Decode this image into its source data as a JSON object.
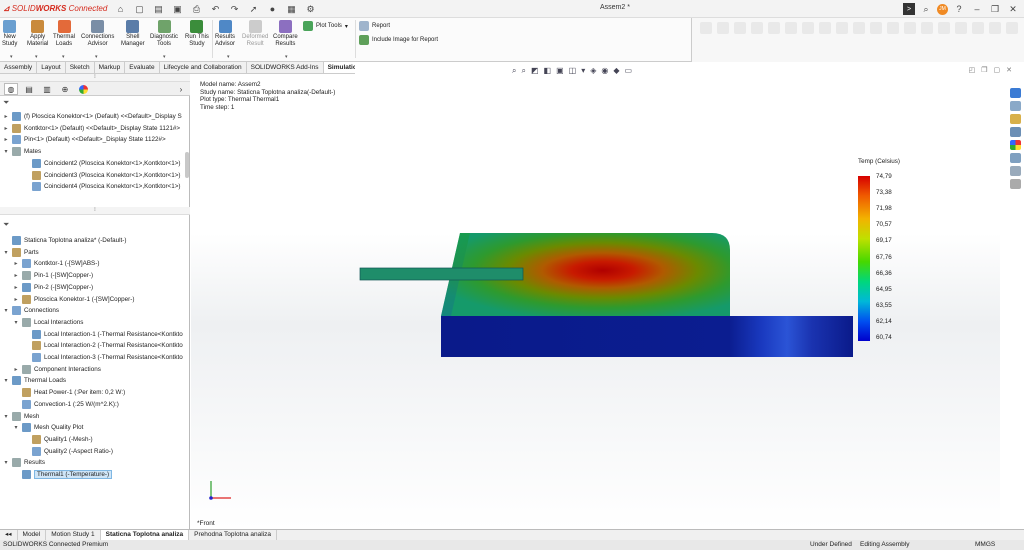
{
  "app": {
    "brand_prefix": "SOLID",
    "brand_bold": "WORKS",
    "brand_rest": " Connected",
    "document_title": "Assem2 *"
  },
  "ribbon": {
    "buttons": [
      {
        "label": "New\nStudy",
        "icon": "new-study-icon"
      },
      {
        "label": "Apply\nMaterial",
        "icon": "apply-material-icon"
      },
      {
        "label": "Thermal\nLoads",
        "icon": "thermal-loads-icon"
      },
      {
        "label": "Connections\nAdvisor",
        "icon": "connections-advisor-icon"
      },
      {
        "label": "Shell\nManager",
        "icon": "shell-manager-icon"
      },
      {
        "label": "Diagnostic\nTools",
        "icon": "diagnostic-tools-icon"
      },
      {
        "label": "Run This\nStudy",
        "icon": "run-study-icon"
      },
      {
        "label": "Results\nAdvisor",
        "icon": "results-advisor-icon"
      },
      {
        "label": "Deformed\nResult",
        "icon": "deformed-result-icon"
      },
      {
        "label": "Compare\nResults",
        "icon": "compare-results-icon"
      }
    ],
    "plot_tools": "Plot Tools",
    "report": "Report",
    "include_image": "Include Image for Report"
  },
  "tabs": [
    "Assembly",
    "Layout",
    "Sketch",
    "Markup",
    "Evaluate",
    "Lifecycle and Collaboration",
    "SOLIDWORKS Add-Ins",
    "Simulation"
  ],
  "active_tab": "Simulation",
  "feature_tree": [
    {
      "text": "(f) Ploscica Konektor<1> (Default) <<Default>_Display S",
      "arrow": "▸"
    },
    {
      "text": "Kontktor<1> (Default) <<Default>_Display State 1121#>",
      "arrow": "▸"
    },
    {
      "text": "Pin<1> (Default) <<Default>_Display State 1122#>",
      "arrow": "▸"
    },
    {
      "text": "Mates",
      "arrow": "▾"
    },
    {
      "text": "Coincident2 (Ploscica Konektor<1>,Kontktor<1>)",
      "arrow": ""
    },
    {
      "text": "Coincident3 (Ploscica Konektor<1>,Kontktor<1>)",
      "arrow": ""
    },
    {
      "text": "Coincident4 (Ploscica Konektor<1>,Kontktor<1>)",
      "arrow": ""
    }
  ],
  "sim_tree": [
    {
      "text": "Staticna Toplotna analiza* (-Default-)",
      "arrow": "",
      "indent": 0
    },
    {
      "text": "Parts",
      "arrow": "▾",
      "indent": 0
    },
    {
      "text": "Kontktor-1 (-[SW]ABS-)",
      "arrow": "▸",
      "indent": 1
    },
    {
      "text": "Pin-1 (-[SW]Copper-)",
      "arrow": "▸",
      "indent": 1
    },
    {
      "text": "Pin-2 (-[SW]Copper-)",
      "arrow": "▸",
      "indent": 1
    },
    {
      "text": "Ploscica Konektor-1 (-[SW]Copper-)",
      "arrow": "▸",
      "indent": 1
    },
    {
      "text": "Connections",
      "arrow": "▾",
      "indent": 0
    },
    {
      "text": "Local Interactions",
      "arrow": "▾",
      "indent": 1
    },
    {
      "text": "Local Interaction-1 (-Thermal Resistance<Kontkto",
      "arrow": "",
      "indent": 2
    },
    {
      "text": "Local Interaction-2 (-Thermal Resistance<Kontkto",
      "arrow": "",
      "indent": 2
    },
    {
      "text": "Local Interaction-3 (-Thermal Resistance<Kontkto",
      "arrow": "",
      "indent": 2
    },
    {
      "text": "Component Interactions",
      "arrow": "▸",
      "indent": 1
    },
    {
      "text": "Thermal Loads",
      "arrow": "▾",
      "indent": 0
    },
    {
      "text": "Heat Power-1 (:Per item: 0,2 W:)",
      "arrow": "",
      "indent": 1
    },
    {
      "text": "Convection-1 (:25 W/(m^2.K):)",
      "arrow": "",
      "indent": 1
    },
    {
      "text": "Mesh",
      "arrow": "▾",
      "indent": 0
    },
    {
      "text": "Mesh Quality Plot",
      "arrow": "▾",
      "indent": 1
    },
    {
      "text": "Quality1 (-Mesh-)",
      "arrow": "",
      "indent": 2
    },
    {
      "text": "Quality2 (-Aspect Ratio-)",
      "arrow": "",
      "indent": 2
    },
    {
      "text": "Results",
      "arrow": "▾",
      "indent": 0
    },
    {
      "text": "Thermal1 (-Temperature-)",
      "arrow": "",
      "indent": 1,
      "selected": true
    }
  ],
  "viewport_info": {
    "model_name": "Model name: Assem2",
    "study_name": "Study name: Staticna Toplotna analiza(-Default-)",
    "plot_type": "Plot type: Thermal Thermal1",
    "time_step": "Time step: 1"
  },
  "legend": {
    "title": "Temp (Celsius)",
    "labels": [
      "74,79",
      "73,38",
      "71,98",
      "70,57",
      "69,17",
      "67,76",
      "66,36",
      "64,95",
      "63,55",
      "62,14",
      "60,74"
    ],
    "colors": {
      "max": "#d60000",
      "mid": "#46d800",
      "min": "#0000cc"
    }
  },
  "view_label": "*Front",
  "bottom_tabs": [
    "Model",
    "Motion Study 1",
    "Staticna Toplotna analiza",
    "Prehodna Toplotna analiza"
  ],
  "active_bottom_tab": "Staticna Toplotna analiza",
  "status": {
    "left": "SOLIDWORKS Connected Premium",
    "under_defined": "Under Defined",
    "editing": "Editing Assembly",
    "units": "MMGS"
  }
}
